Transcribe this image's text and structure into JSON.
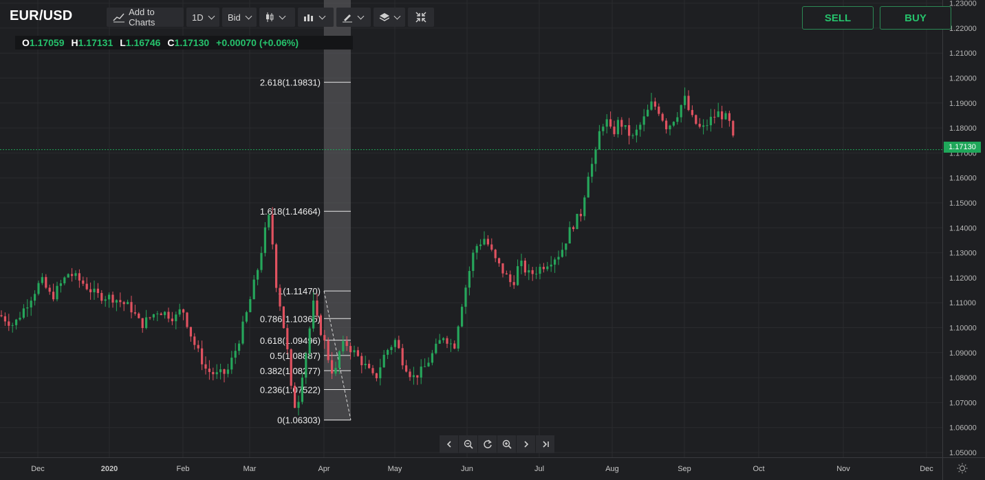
{
  "header": {
    "symbol": "EUR/USD",
    "toolbar": {
      "add_to_charts": "Add to Charts",
      "interval": "1D",
      "price_type": "Bid"
    },
    "ohlc": {
      "o_key": "O",
      "o_val": "1.17059",
      "h_key": "H",
      "h_val": "1.17131",
      "l_key": "L",
      "l_val": "1.16746",
      "c_key": "C",
      "c_val": "1.17130",
      "change": "+0.00070 (+0.06%)"
    },
    "sell_label": "SELL",
    "buy_label": "BUY"
  },
  "current_price": "1.17130",
  "colors": {
    "background": "#1e1f22",
    "up": "#26a65b",
    "down": "#e05260",
    "accent": "#26c26c",
    "grid": "#2a2b2e"
  },
  "icons": [
    "line-chart-icon",
    "candlestick-icon",
    "bar-volume-icon",
    "drawing-pen-icon",
    "layers-icon",
    "collapse-icon",
    "chevron-left-icon",
    "zoom-out-icon",
    "reset-icon",
    "zoom-in-icon",
    "chevron-right-icon",
    "skip-end-icon",
    "settings-sun-icon"
  ],
  "fibonacci": [
    {
      "label": "2.618(1.19831)",
      "price": 1.19831
    },
    {
      "label": "1.618(1.14664)",
      "price": 1.14664
    },
    {
      "label": "1(1.11470)",
      "price": 1.1147
    },
    {
      "label": "0.786(1.10365)",
      "price": 1.10365
    },
    {
      "label": "0.618(1.09496)",
      "price": 1.09496
    },
    {
      "label": "0.5(1.08887)",
      "price": 1.08887
    },
    {
      "label": "0.382(1.08277)",
      "price": 1.08277
    },
    {
      "label": "0.236(1.07522)",
      "price": 1.07522
    },
    {
      "label": "0(1.06303)",
      "price": 1.06303
    }
  ],
  "chart_data": {
    "type": "candlestick",
    "title": "EUR/USD",
    "y_ticks": [
      "1.05000",
      "1.06000",
      "1.07000",
      "1.08000",
      "1.09000",
      "1.10000",
      "1.11000",
      "1.12000",
      "1.13000",
      "1.14000",
      "1.15000",
      "1.16000",
      "1.17000",
      "1.18000",
      "1.19000",
      "1.20000",
      "1.21000",
      "1.22000",
      "1.23000"
    ],
    "x_ticks": [
      "Dec",
      "2020",
      "Feb",
      "Mar",
      "Apr",
      "May",
      "Jun",
      "Jul",
      "Aug",
      "Sep",
      "Oct",
      "Nov",
      "Dec"
    ],
    "ylim": [
      1.045,
      1.23
    ],
    "grid": true,
    "anchors": [
      [
        0,
        1.105
      ],
      [
        20,
        1.101
      ],
      [
        40,
        1.11
      ],
      [
        60,
        1.119
      ],
      [
        75,
        1.112
      ],
      [
        100,
        1.122
      ],
      [
        120,
        1.118
      ],
      [
        140,
        1.113
      ],
      [
        165,
        1.112
      ],
      [
        190,
        1.108
      ],
      [
        205,
        1.101
      ],
      [
        230,
        1.107
      ],
      [
        255,
        1.104
      ],
      [
        265,
        1.108
      ],
      [
        280,
        1.095
      ],
      [
        300,
        1.083
      ],
      [
        315,
        1.081
      ],
      [
        330,
        1.082
      ],
      [
        345,
        1.093
      ],
      [
        360,
        1.107
      ],
      [
        375,
        1.124
      ],
      [
        390,
        1.145
      ],
      [
        395,
        1.138
      ],
      [
        400,
        1.12
      ],
      [
        410,
        1.105
      ],
      [
        418,
        1.09
      ],
      [
        425,
        1.07
      ],
      [
        432,
        1.068
      ],
      [
        440,
        1.083
      ],
      [
        448,
        1.095
      ],
      [
        455,
        1.11
      ],
      [
        462,
        1.102
      ],
      [
        470,
        1.096
      ],
      [
        478,
        1.087
      ],
      [
        486,
        1.08
      ],
      [
        494,
        1.091
      ],
      [
        502,
        1.094
      ],
      [
        515,
        1.09
      ],
      [
        530,
        1.085
      ],
      [
        545,
        1.079
      ],
      [
        560,
        1.09
      ],
      [
        575,
        1.095
      ],
      [
        585,
        1.087
      ],
      [
        600,
        1.08
      ],
      [
        615,
        1.083
      ],
      [
        630,
        1.09
      ],
      [
        645,
        1.097
      ],
      [
        660,
        1.092
      ],
      [
        670,
        1.108
      ],
      [
        680,
        1.12
      ],
      [
        690,
        1.132
      ],
      [
        705,
        1.136
      ],
      [
        720,
        1.127
      ],
      [
        735,
        1.121
      ],
      [
        745,
        1.117
      ],
      [
        755,
        1.126
      ],
      [
        770,
        1.121
      ],
      [
        785,
        1.124
      ],
      [
        800,
        1.127
      ],
      [
        815,
        1.13
      ],
      [
        830,
        1.14
      ],
      [
        845,
        1.146
      ],
      [
        855,
        1.162
      ],
      [
        865,
        1.168
      ],
      [
        872,
        1.179
      ],
      [
        880,
        1.184
      ],
      [
        890,
        1.177
      ],
      [
        900,
        1.183
      ],
      [
        910,
        1.179
      ],
      [
        920,
        1.176
      ],
      [
        935,
        1.183
      ],
      [
        948,
        1.19
      ],
      [
        958,
        1.187
      ],
      [
        970,
        1.18
      ],
      [
        985,
        1.186
      ],
      [
        995,
        1.192
      ],
      [
        1005,
        1.184
      ],
      [
        1020,
        1.179
      ],
      [
        1035,
        1.184
      ],
      [
        1045,
        1.186
      ],
      [
        1055,
        1.184
      ],
      [
        1062,
        1.181
      ],
      [
        1068,
        1.172
      ],
      [
        1070,
        1.1713
      ]
    ]
  }
}
